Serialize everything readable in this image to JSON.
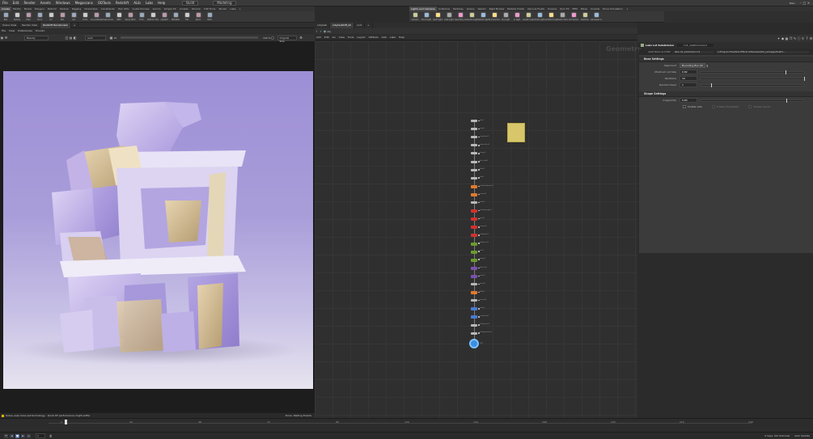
{
  "menubar": {
    "items": [
      "File",
      "Edit",
      "Render",
      "Assets",
      "Windows",
      "Megascans",
      "ODTools",
      "Redshift",
      "ALib",
      "Labs",
      "Help"
    ],
    "build": "Build",
    "desktop": "Modeling",
    "right_label": "Main"
  },
  "shelf_left": {
    "tabs": [
      "Create",
      "Modify",
      "Model",
      "Polygon",
      "Deform",
      "Texture",
      "Rigging",
      "Characters",
      "Constraints",
      "Hair Utils",
      "Guide Process",
      "Groom",
      "Simple FX",
      "Crowds",
      "Volume",
      "TOP Tools",
      "Terrain",
      "Labs"
    ],
    "tools": [
      "Box",
      "Sphere",
      "Tube",
      "Torus",
      "Grid",
      "Null",
      "Line",
      "Circle",
      "Curve Bezier",
      "Draw Curve",
      "Path",
      "Spray Paint",
      "Font",
      "Platonic Solids",
      "L-System",
      "Metaball",
      "File",
      "Spiral",
      "Helix"
    ]
  },
  "shelf_right": {
    "tabs": [
      "Lights and Cameras",
      "Collisions",
      "Particles",
      "Grains",
      "Vellum",
      "Rigid Bodies",
      "Particle Fluids",
      "Viscous Fluids",
      "Oceans",
      "Pyro FX",
      "FEM",
      "Wires",
      "Crowds",
      "Drive Simulation"
    ],
    "tools": [
      "Camera",
      "Point Light",
      "Spot Light",
      "Area Light",
      "Geometry Light",
      "Volume Light",
      "Distant Light",
      "Environment Light",
      "Sky Light",
      "GI Light",
      "Caustic Light",
      "Portal Light",
      "Ambient Light",
      "Stereo Camera",
      "VR Camera",
      "Switcher",
      "Gamepad Camera"
    ]
  },
  "left_pane": {
    "tabs": [
      "Scene View",
      "Render View",
      "Redshift Renderview"
    ],
    "menu": [
      "File",
      "View",
      "Preferences",
      "Houdini"
    ],
    "toolbar": {
      "display": "Beauty",
      "aov": "Auto",
      "zoom": "100 %",
      "size": "Original Size"
    },
    "status_left": "Scene uses Irane set technology - Quick RT performance might suffer",
    "status_right": "Done. Waiting Events"
  },
  "network": {
    "tabs": [
      "/obj/Lab",
      "/obj/redshift_ibl",
      "/out"
    ],
    "path": "obj",
    "menu": [
      "Add",
      "Edit",
      "Go",
      "View",
      "Tools",
      "Layout",
      "ODTools",
      "ALib",
      "Labs",
      "Help"
    ],
    "watermark": "Geometry",
    "node_labels": [
      "box1",
      "copy1",
      "transform1",
      "polyreduce1",
      "merge1",
      "lab_subd1",
      "blast1",
      "fuse1",
      "attribrandomize1",
      "normal1",
      "color1",
      "attribwrangle1",
      "peak1",
      "remesh1",
      "subdivide1",
      "polybevel1",
      "sort1",
      "group1",
      "labs_lot1",
      "clean1",
      "lab_fit1",
      "blast2",
      "normal2",
      "color2",
      "matchsize1",
      "attribnoise1",
      "attribpromote1",
      "OUT"
    ]
  },
  "parameters": {
    "node_type": "Labs Lot Subdivision",
    "node_name": "lot_subdivision1",
    "path_label": "Asset Name and Path",
    "asset_name": "labs::lot_subdivision:2.0",
    "asset_path": "C:/Program Files/Side Effects Software/sidefx_packages/SideFx...",
    "sections": {
      "base": "Base Settings",
      "shape": "Shape Settings"
    },
    "base_params": [
      {
        "label": "Alignment",
        "value": "Bounding Box XZ",
        "type": "dropdown"
      },
      {
        "label": "Minimum Lot Size",
        "value": "0.82",
        "type": "float",
        "fill": 0.82
      },
      {
        "label": "Iterations",
        "value": "10",
        "type": "int",
        "fill": 1.0
      },
      {
        "label": "Random Seed",
        "value": "1",
        "type": "int",
        "fill": 0.1
      }
    ],
    "shape_params": [
      {
        "label": "Irregularity",
        "value": "0.83",
        "type": "float",
        "fill": 0.83
      }
    ],
    "shape_toggles": [
      "Cluster Lots",
      "Cluster Probability",
      "Cluster Count"
    ]
  },
  "timeline": {
    "frame": "1",
    "ticks": [
      "1",
      "24",
      "48",
      "72",
      "96",
      "120",
      "144",
      "168",
      "192",
      "216",
      "240"
    ],
    "range_label": "0 keys, 0/0 channels",
    "auto_update": "Auto Update"
  }
}
